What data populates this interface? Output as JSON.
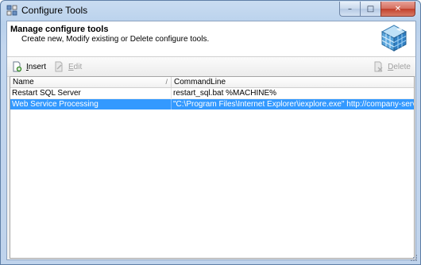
{
  "window": {
    "title": "Configure Tools",
    "minimize_glyph": "–",
    "maximize_glyph": "□",
    "close_glyph": "✕"
  },
  "header": {
    "title": "Manage configure tools",
    "description": "Create new, Modify existing or Delete configure tools.",
    "icon": "cube-icon"
  },
  "toolbar": {
    "insert_label": "Insert",
    "edit_label": "Edit",
    "delete_label": "Delete"
  },
  "grid": {
    "columns": [
      "Name",
      "CommandLine"
    ],
    "sort_indicator": "/",
    "rows": [
      {
        "name": "Restart SQL Server",
        "command": "restart_sql.bat %MACHINE%",
        "selected": false
      },
      {
        "name": "Web Service Processing",
        "command": "\"C:\\Program Files\\Internet Explorer\\iexplore.exe\" http://company-server.com/se",
        "selected": true
      }
    ]
  },
  "colors": {
    "selection": "#3399ff",
    "title_gradient": "#b9d1ec",
    "close_button": "#c2402b"
  }
}
